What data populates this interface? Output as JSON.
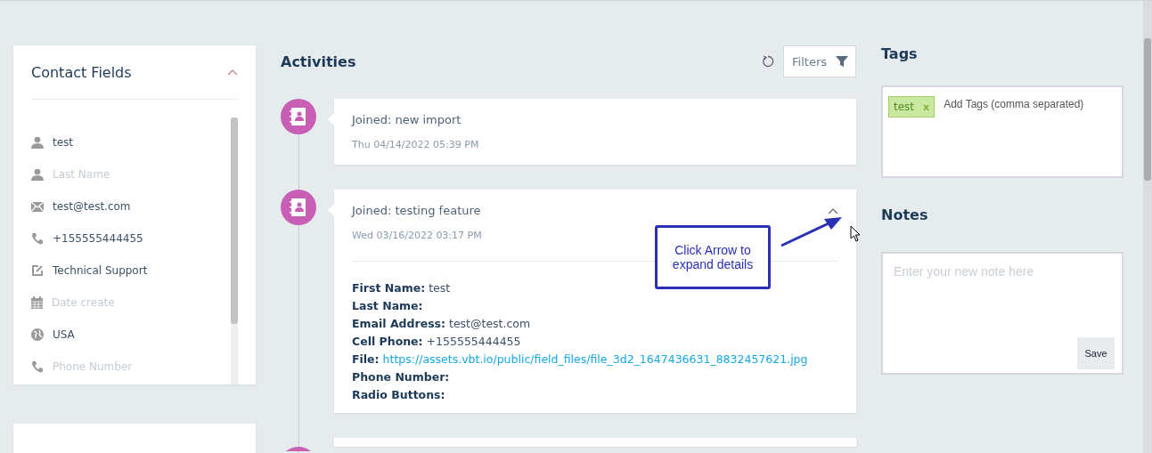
{
  "contact_fields": {
    "title": "Contact Fields",
    "expanded": true,
    "items": [
      {
        "kind": "person",
        "text": "test",
        "empty": false
      },
      {
        "kind": "person",
        "text": "Last Name",
        "empty": true
      },
      {
        "kind": "email",
        "text": "test@test.com",
        "empty": false
      },
      {
        "kind": "phone",
        "text": "+155555444455",
        "empty": false
      },
      {
        "kind": "text",
        "text": "Technical Support",
        "empty": false
      },
      {
        "kind": "date",
        "text": "Date create",
        "empty": true
      },
      {
        "kind": "country",
        "text": "USA",
        "empty": false
      },
      {
        "kind": "phone",
        "text": "Phone Number",
        "empty": true
      }
    ]
  },
  "activities": {
    "title": "Activities",
    "filters_label": "Filters",
    "items": [
      {
        "title": "Joined: new import",
        "date": "Thu 04/14/2022 05:39 PM",
        "expanded": false
      },
      {
        "title": "Joined: testing feature",
        "date": "Wed 03/16/2022 03:17 PM",
        "expanded": true,
        "details": [
          {
            "label": "First Name:",
            "value": "test",
            "kind": "text"
          },
          {
            "label": "Last Name:"
          },
          {
            "label": "Email Address:",
            "value": "test@test.com",
            "kind": "text"
          },
          {
            "label": "Cell Phone:",
            "value": "+155555444455",
            "kind": "text"
          },
          {
            "label": "File:",
            "value": "https://assets.vbt.io/public/field_files/file_3d2_1647436631_8832457621.jpg",
            "kind": "link"
          },
          {
            "label": "Phone Number:"
          },
          {
            "label": "Radio Buttons:"
          }
        ]
      }
    ]
  },
  "annotation": {
    "text": "Click Arrow to expand details"
  },
  "tags": {
    "title": "Tags",
    "items": [
      {
        "label": "test",
        "remove": "x"
      }
    ],
    "placeholder": "Add Tags (comma separated)"
  },
  "notes": {
    "title": "Notes",
    "placeholder": "Enter your new note here",
    "save_label": "Save"
  }
}
